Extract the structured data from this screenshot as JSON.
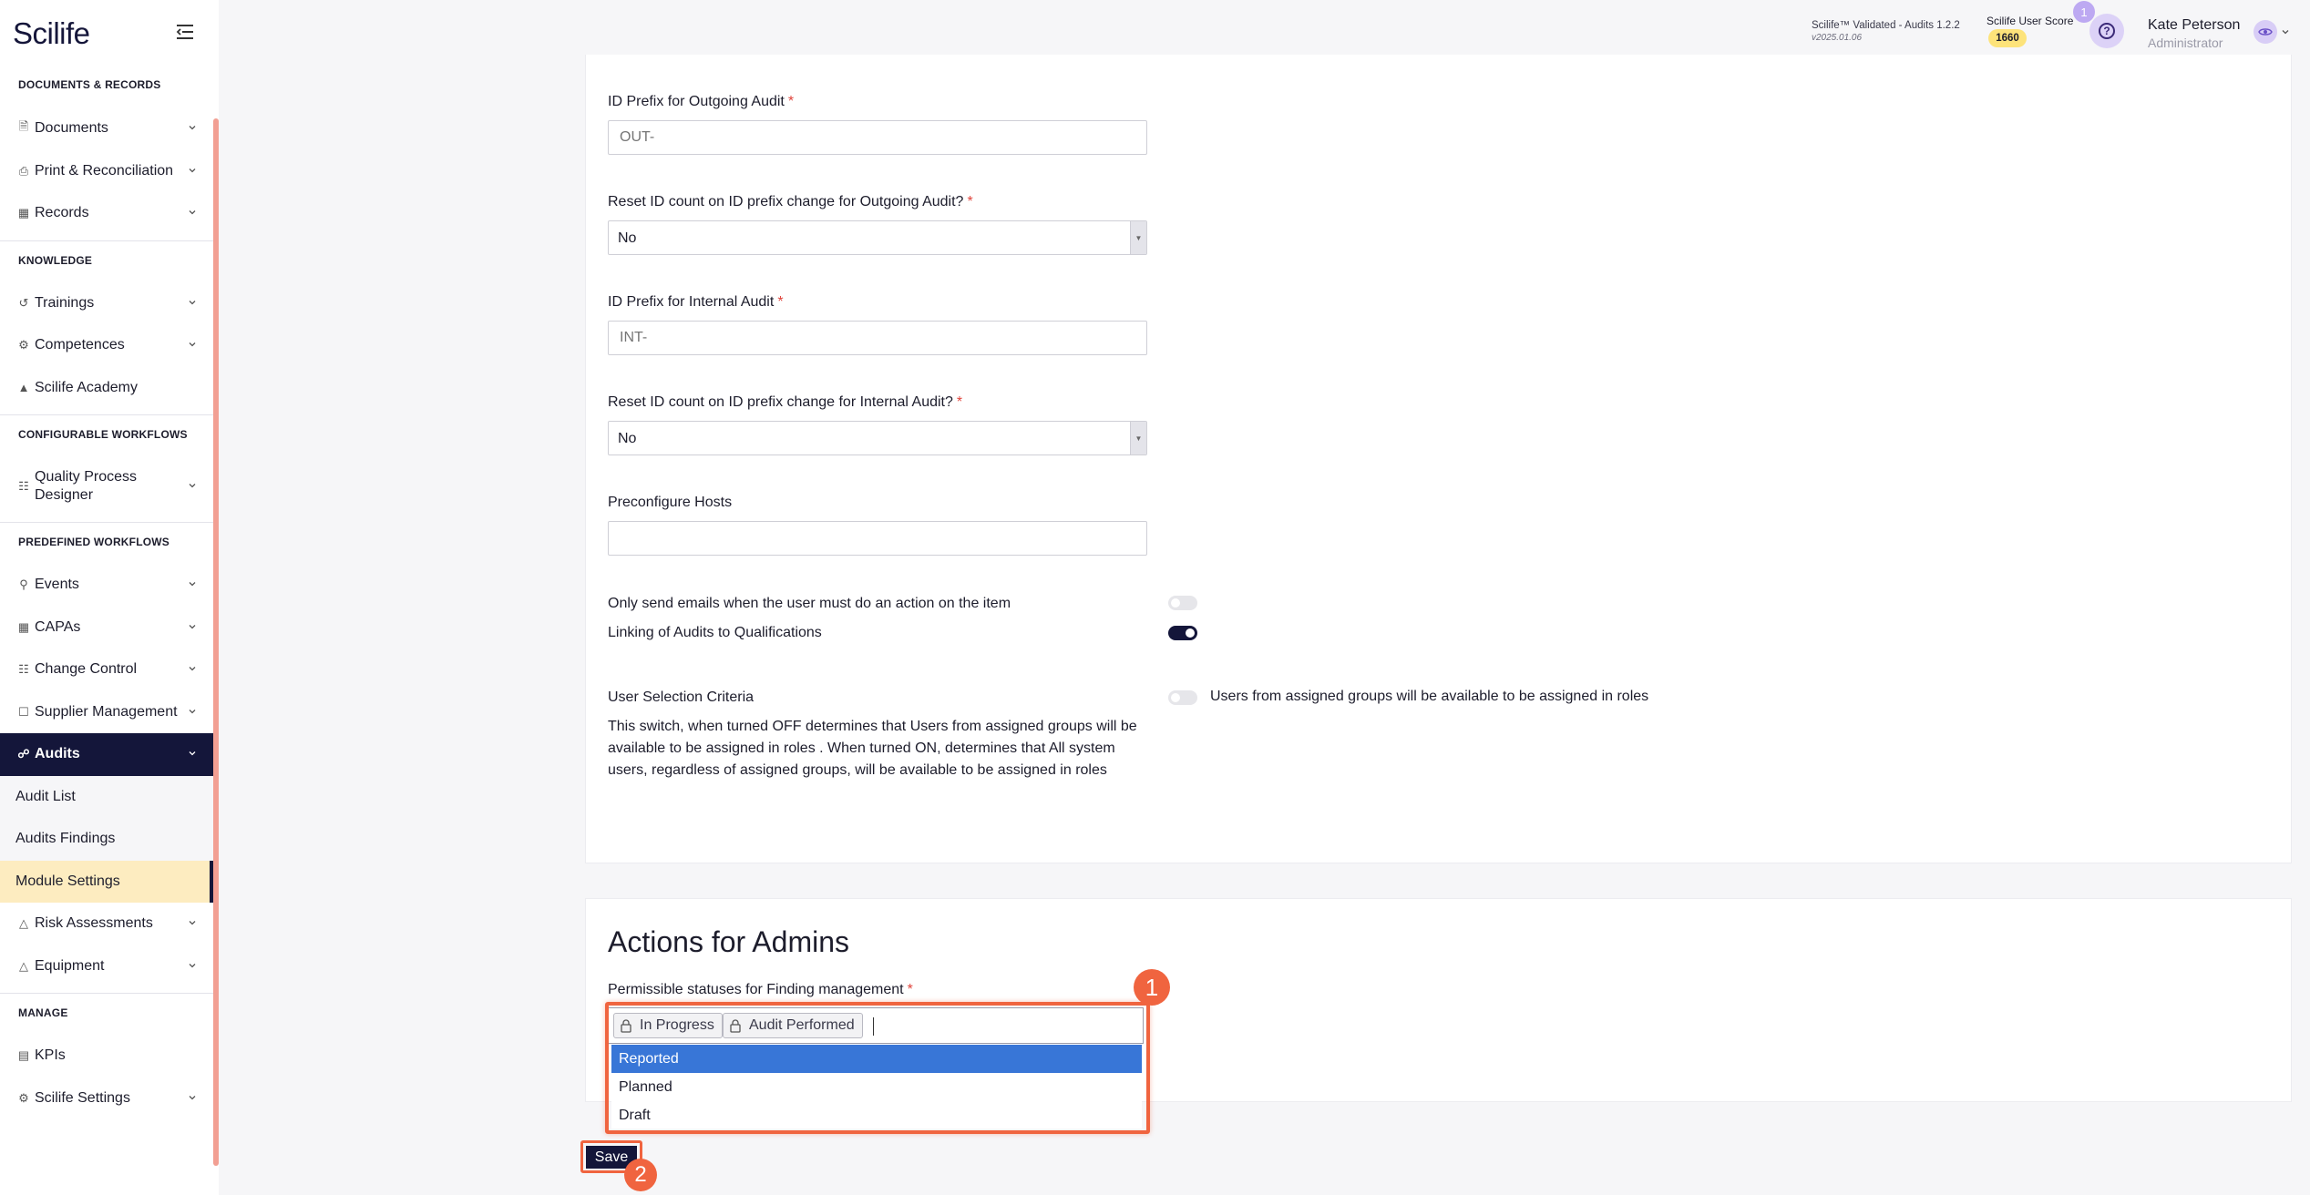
{
  "app": {
    "brand": "Scilife"
  },
  "topbar": {
    "validated": "Scilife™ Validated - Audits 1.2.2",
    "version": "v2025.01.06",
    "score_label": "Scilife User Score",
    "score_value": "1660",
    "notification_count": "1",
    "user_name": "Kate Peterson",
    "user_role": "Administrator"
  },
  "sidebar": {
    "sections": {
      "documents": "DOCUMENTS & RECORDS",
      "knowledge": "KNOWLEDGE",
      "configurable": "CONFIGURABLE WORKFLOWS",
      "predefined": "PREDEFINED WORKFLOWS",
      "manage": "MANAGE"
    },
    "items": {
      "documents": "Documents",
      "print": "Print & Reconciliation",
      "records": "Records",
      "trainings": "Trainings",
      "competences": "Competences",
      "academy": "Scilife Academy",
      "qpd": "Quality Process Designer",
      "events": "Events",
      "capas": "CAPAs",
      "change": "Change Control",
      "supplier": "Supplier Management",
      "audits": "Audits",
      "audit_list": "Audit List",
      "audit_findings": "Audits Findings",
      "module_settings": "Module Settings",
      "risk": "Risk Assessments",
      "equipment": "Equipment",
      "kpis": "KPIs",
      "settings": "Scilife Settings"
    }
  },
  "form": {
    "outgoing_prefix_label": "ID Prefix for Outgoing Audit",
    "outgoing_prefix_placeholder": "OUT-",
    "outgoing_reset_label": "Reset ID count on ID prefix change for Outgoing Audit?",
    "outgoing_reset_value": "No",
    "internal_prefix_label": "ID Prefix for Internal Audit",
    "internal_prefix_placeholder": "INT-",
    "internal_reset_label": "Reset ID count on ID prefix change for Internal Audit?",
    "internal_reset_value": "No",
    "hosts_label": "Preconfigure Hosts",
    "only_emails_label": "Only send emails when the user must do an action on the item",
    "only_emails_on": false,
    "linking_label": "Linking of Audits to Qualifications",
    "linking_on": true,
    "selection_label": "User Selection Criteria",
    "selection_on": false,
    "selection_toggle_text": "Users from assigned groups will be available to be assigned in roles",
    "selection_desc": "This switch, when turned OFF determines that Users from assigned groups will be available to be assigned in roles . When turned ON, determines that All system users, regardless of assigned groups, will be available to be assigned in roles",
    "required_mark": "*"
  },
  "admin": {
    "heading": "Actions for Admins",
    "statuses_label": "Permissible statuses for Finding management",
    "tags": [
      "In Progress",
      "Audit Performed"
    ],
    "options": [
      "Reported",
      "Planned",
      "Draft"
    ]
  },
  "callouts": {
    "one": "1",
    "two": "2"
  },
  "actions": {
    "save": "Save"
  },
  "colors": {
    "accent": "#14163a",
    "highlight": "#f0643f",
    "selected_option": "#3876d7",
    "selected_nav": "#fdecc0"
  }
}
